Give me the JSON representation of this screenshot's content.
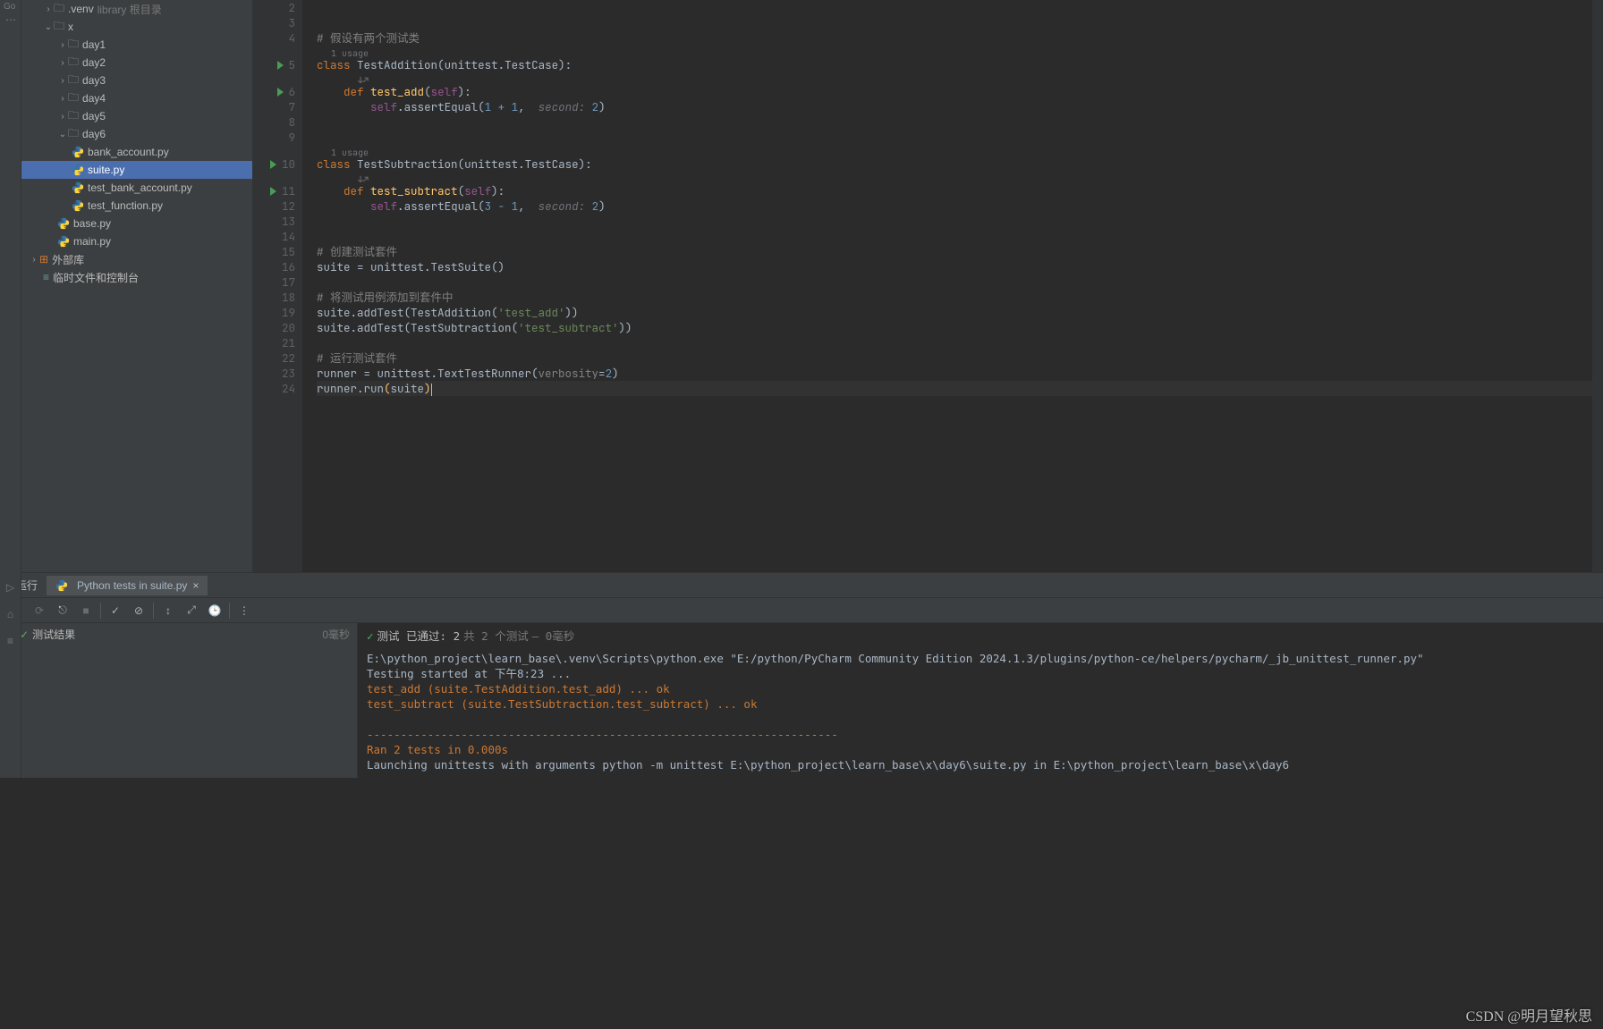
{
  "tree": {
    "venv": ".venv",
    "venv_hint": "library 根目录",
    "x": "x",
    "days": [
      "day1",
      "day2",
      "day3",
      "day4",
      "day5",
      "day6"
    ],
    "day6_files": [
      "bank_account.py",
      "suite.py",
      "test_bank_account.py",
      "test_function.py"
    ],
    "base": "base.py",
    "main": "main.py",
    "ext_lib": "外部库",
    "scratch": "临时文件和控制台"
  },
  "editor": {
    "line_numbers": [
      2,
      3,
      4,
      5,
      6,
      7,
      8,
      9,
      10,
      11,
      12,
      13,
      14,
      15,
      16,
      17,
      18,
      19,
      20,
      21,
      22,
      23,
      24
    ],
    "usage_hint": "1 usage",
    "comment_two_classes": "# 假设有两个测试类",
    "comment_create_suite": "# 创建测试套件",
    "comment_add_cases": "# 将测试用例添加到套件中",
    "comment_run_suite": "# 运行测试套件",
    "class_add": "TestAddition",
    "class_sub": "TestSubtraction",
    "testcase": "unittest.TestCase",
    "def_add": "test_add",
    "def_sub": "test_subtract",
    "self": "self",
    "assert_eq": "assertEqual",
    "expr_add": "1 + 1",
    "expr_sub": "3 - 1",
    "hint_second": "second:",
    "val_2": "2",
    "suite_assign": "suite = unittest.TestSuite()",
    "add_test_1_a": "suite.addTest(TestAddition(",
    "add_test_1_b": "'test_add'",
    "add_test_1_c": "))",
    "add_test_2_a": "suite.addTest(TestSubtraction(",
    "add_test_2_b": "'test_subtract'",
    "add_test_2_c": "))",
    "runner_a": "runner = unittest.TextTestRunner(",
    "runner_b": "verbosity",
    "runner_c": "=",
    "runner_d": "2",
    "runner_e": ")",
    "run_a": "runner.run",
    "run_b": "suite"
  },
  "run_panel": {
    "tab_run": "运行",
    "tab_tests": "Python tests in suite.py",
    "tree_root": "测试结果",
    "tree_time": "0毫秒",
    "summary_a": "测试 已通过: 2",
    "summary_b": "共 2 个测试",
    "summary_c": " – 0毫秒",
    "out_exe": "E:\\python_project\\learn_base\\.venv\\Scripts\\python.exe \"E:/python/PyCharm Community Edition 2024.1.3/plugins/python-ce/helpers/pycharm/_jb_unittest_runner.py\"",
    "out_start": "Testing started at 下午8:23 ...",
    "out_add": "test_add (suite.TestAddition.test_add) ... ok",
    "out_sub": "test_subtract (suite.TestSubtraction.test_subtract) ... ok",
    "out_sep": "----------------------------------------------------------------------",
    "out_ran": "Ran 2 tests in 0.000s",
    "out_launch": "Launching unittests with arguments python -m unittest E:\\python_project\\learn_base\\x\\day6\\suite.py in E:\\python_project\\learn_base\\x\\day6"
  },
  "watermark": "CSDN @明月望秋思",
  "chart_data": null
}
